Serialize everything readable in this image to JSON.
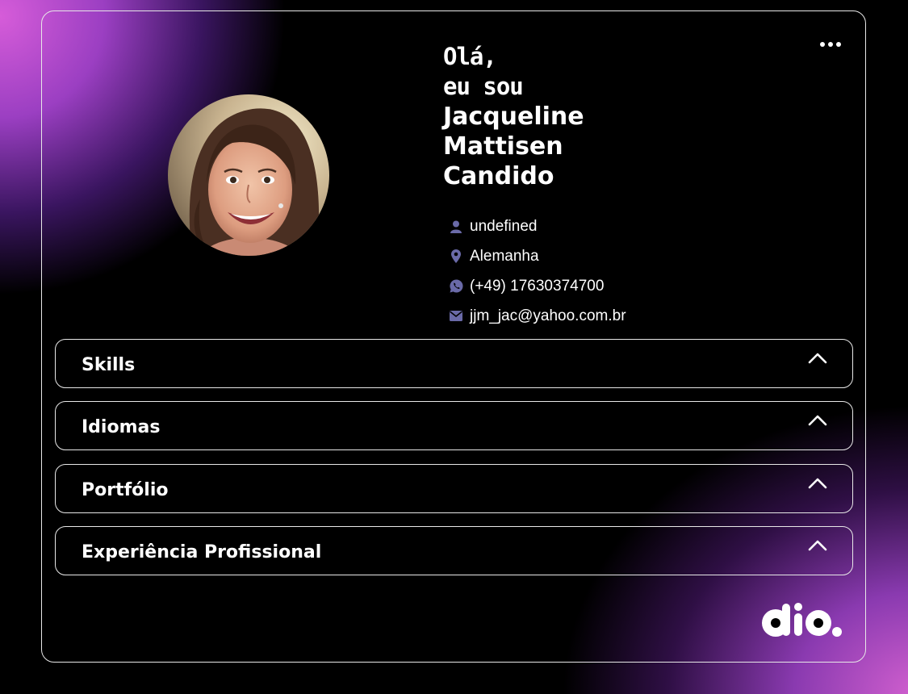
{
  "profile": {
    "greeting_line1": "Olá,",
    "greeting_line2": "eu sou",
    "name_line1": "Jacqueline",
    "name_line2": "Mattisen",
    "name_line3": "Candido",
    "photo_alt": "Jacqueline Mattisen Candido"
  },
  "info": {
    "job": "undefined",
    "location": "Alemanha",
    "phone": "(+49) 17630374700",
    "email": "jjm_jac@yahoo.com.br"
  },
  "sections": [
    {
      "label": "Skills"
    },
    {
      "label": "Idiomas"
    },
    {
      "label": "Portfólio"
    },
    {
      "label": "Experiência Profissional"
    }
  ],
  "icons": {
    "menu": "more-horizontal-icon",
    "job": "user-icon",
    "location": "map-pin-icon",
    "phone": "whatsapp-icon",
    "email": "mail-icon",
    "accordion": "chevron-up-icon",
    "brand": "dio-logo"
  },
  "colors": {
    "background": "#000000",
    "icon_accent": "#6a6aa8",
    "gradient_pink": "#d65cd9",
    "gradient_purple": "#8a3ab0",
    "text": "#ffffff",
    "border": "#e8e8e8"
  }
}
